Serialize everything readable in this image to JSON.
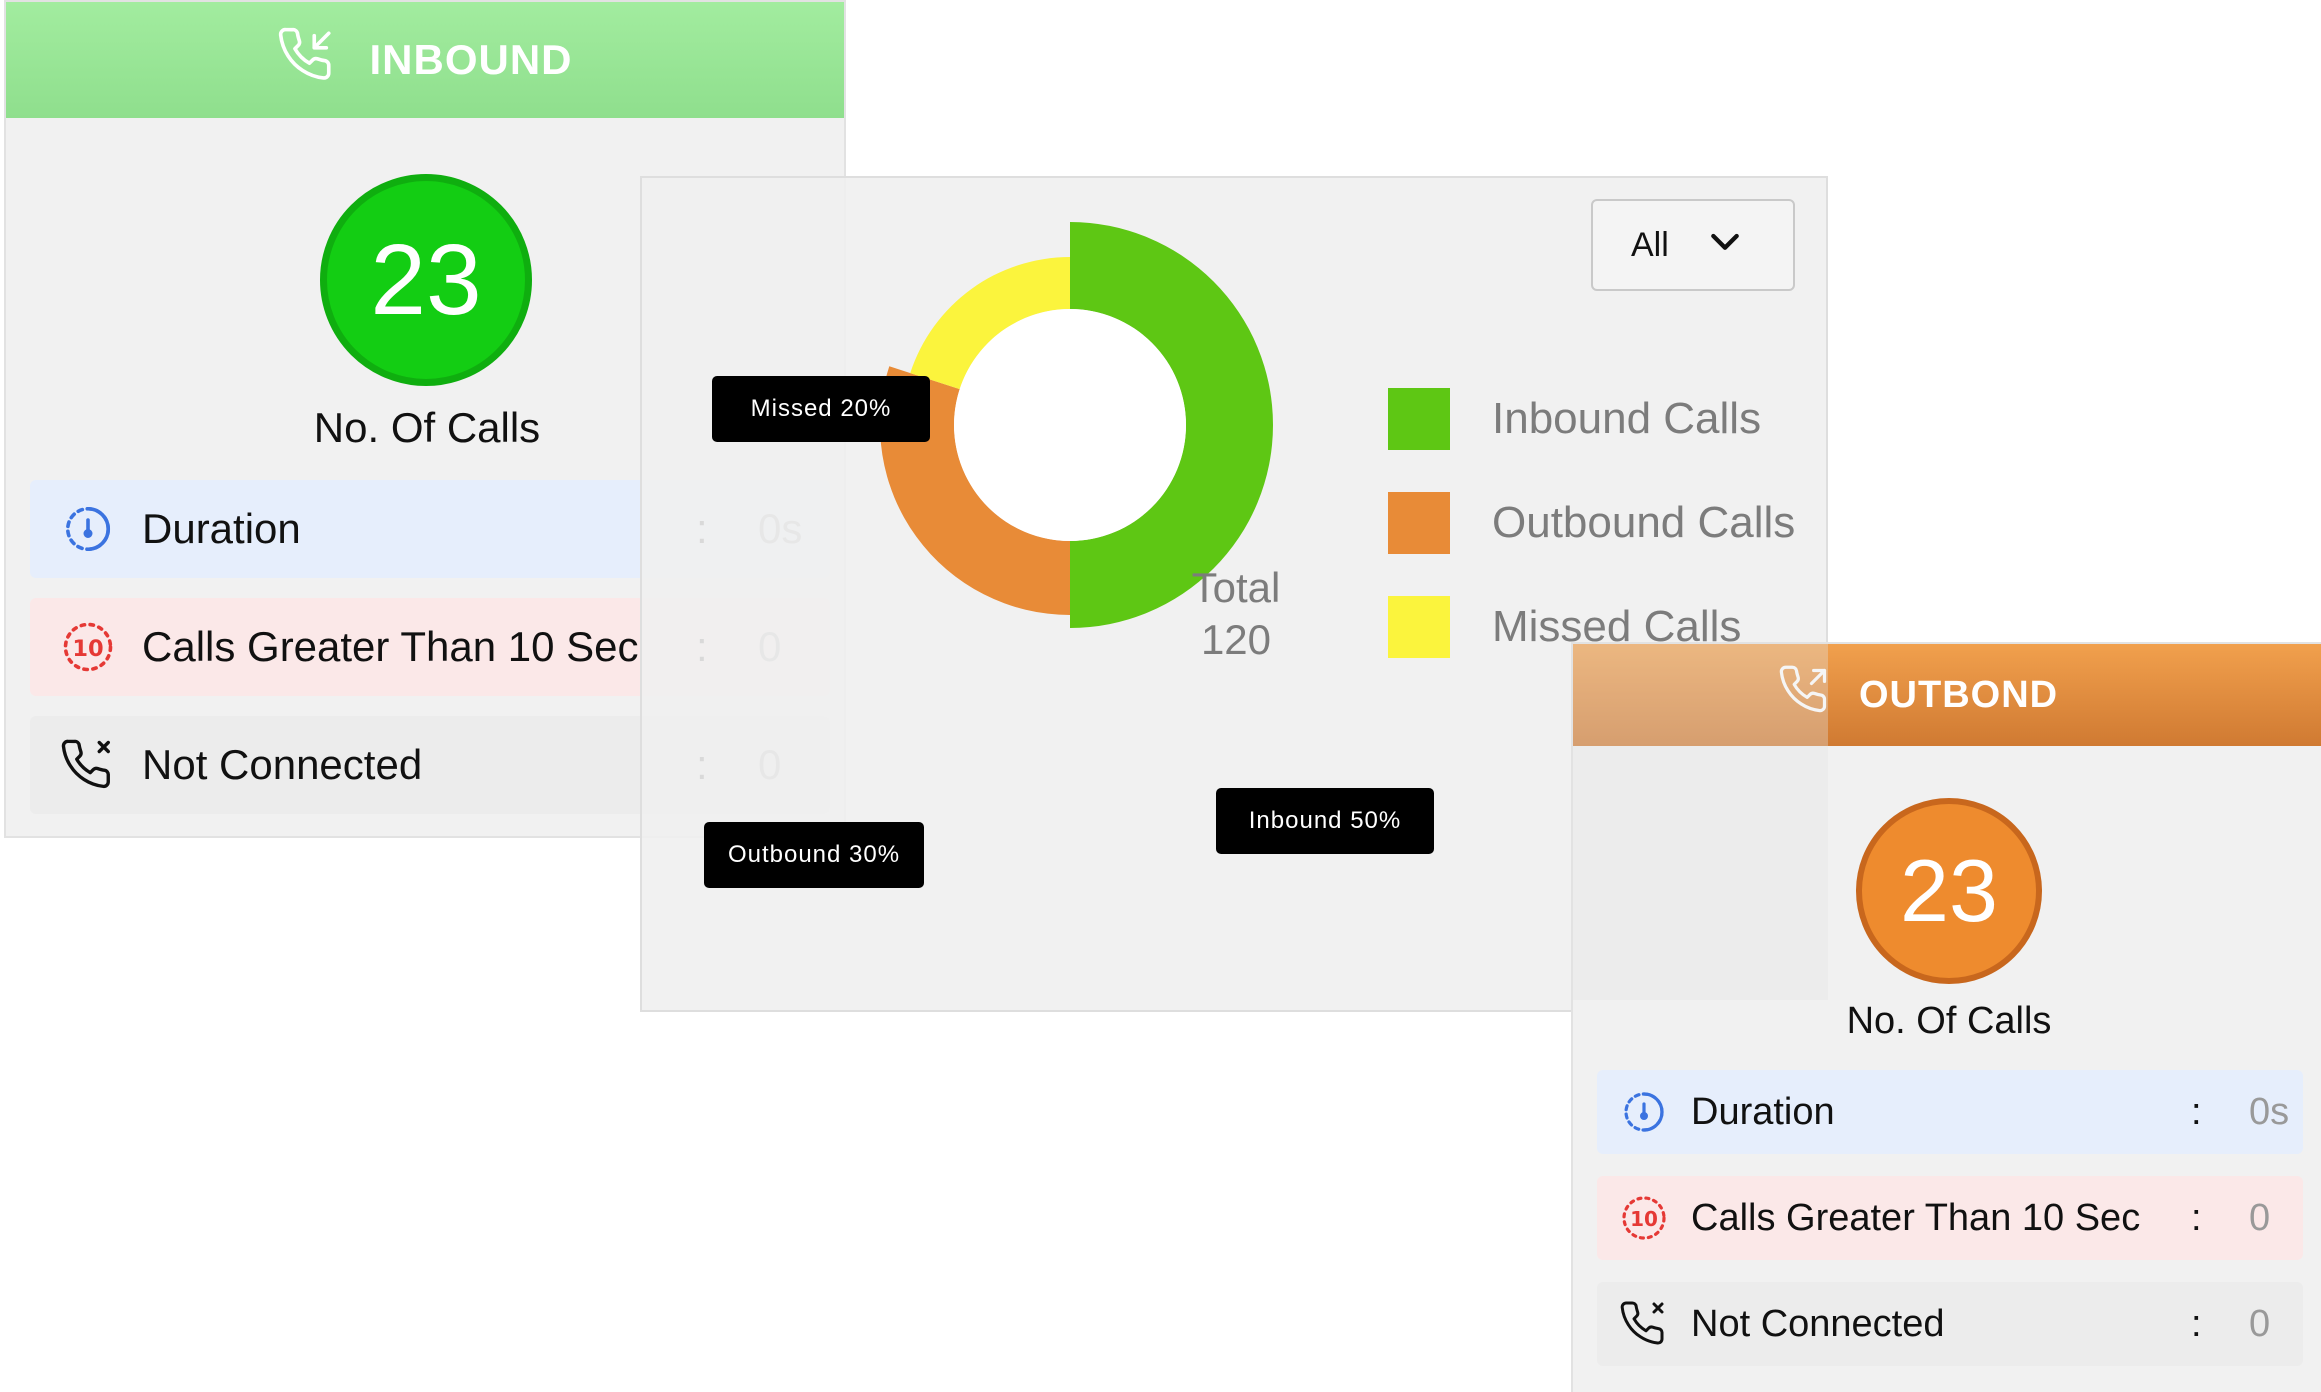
{
  "inbound": {
    "title": "INBOUND",
    "icon": "phone-incoming-icon",
    "count": "23",
    "count_label": "No. Of Calls",
    "header_color": "#98e696",
    "bubble_color": "#13cd13",
    "rows": [
      {
        "label": "Duration",
        "colon": ":",
        "value": "0s",
        "icon": "timer-icon"
      },
      {
        "label": "Calls Greater Than 10 Sec",
        "colon": ":",
        "value": "0",
        "icon": "ten-seconds-icon"
      },
      {
        "label": "Not Connected",
        "colon": ":",
        "value": "0",
        "icon": "phone-missed-icon"
      }
    ]
  },
  "chart_card": {
    "filter": {
      "selected": "All",
      "icon": "chevron-down-icon"
    },
    "center": {
      "line1": "Total",
      "line2": "120"
    },
    "tooltips": {
      "missed": "Missed 20%",
      "inbound": "Inbound 50%",
      "outbound": "Outbound 30%"
    }
  },
  "chart_data": {
    "type": "pie",
    "donut": true,
    "categories": [
      "Inbound Calls",
      "Outbound Calls",
      "Missed Calls"
    ],
    "values": [
      50,
      30,
      20
    ],
    "unit": "%",
    "total": 120,
    "colors": [
      "#5ec714",
      "#e88b37",
      "#fbf43d"
    ],
    "legend": {
      "placement": "right"
    }
  },
  "outbound": {
    "title": "OUTBOND",
    "icon": "phone-outgoing-icon",
    "count": "23",
    "count_label": "No. Of Calls",
    "header_color": "#e58b3c",
    "bubble_color": "#ee8b2e",
    "rows": [
      {
        "label": "Duration",
        "colon": ":",
        "value": "0s",
        "icon": "timer-icon"
      },
      {
        "label": "Calls Greater Than 10 Sec",
        "colon": ":",
        "value": "0",
        "icon": "ten-seconds-icon"
      },
      {
        "label": "Not Connected",
        "colon": ":",
        "value": "0",
        "icon": "phone-missed-icon"
      }
    ]
  }
}
